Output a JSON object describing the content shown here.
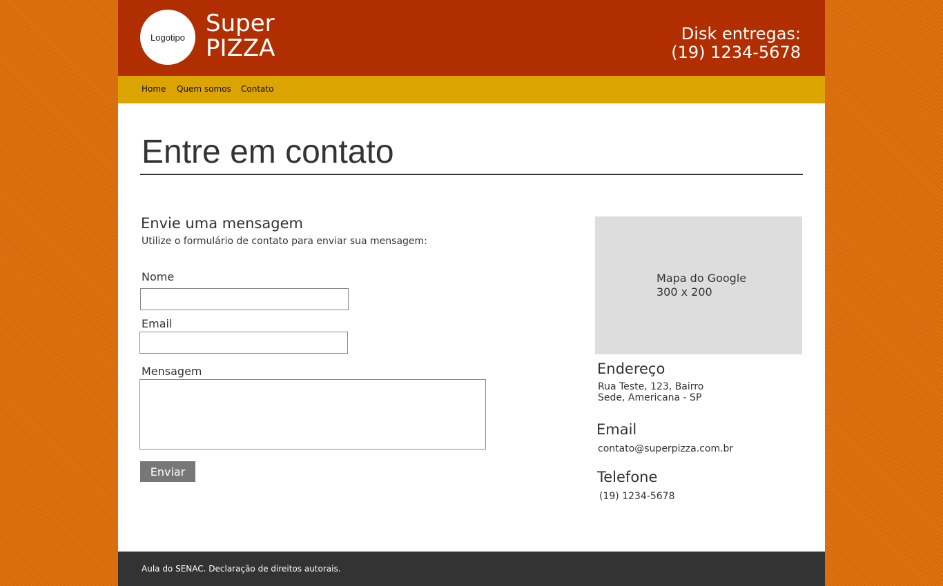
{
  "header": {
    "logo_text": "Logotipo",
    "brand_line1": "Super",
    "brand_line2": "PIZZA",
    "delivery_line1": "Disk entregas:",
    "delivery_line2": "(19) 1234-5678"
  },
  "nav": {
    "items": [
      {
        "label": "Home"
      },
      {
        "label": "Quem somos"
      },
      {
        "label": "Contato"
      }
    ]
  },
  "main": {
    "title": "Entre em contato"
  },
  "form": {
    "heading": "Envie uma mensagem",
    "subtitle": "Utilize o formulário de contato para enviar sua mensagem:",
    "name_label": "Nome",
    "name_value": "",
    "email_label": "Email",
    "email_value": "",
    "message_label": "Mensagem",
    "message_value": "",
    "submit_label": "Enviar"
  },
  "sidebar": {
    "map_line1": "Mapa do Google",
    "map_line2": "300 x 200",
    "address_heading": "Endereço",
    "address_line1": "Rua Teste, 123, Bairro",
    "address_line2": "Sede, Americana - SP",
    "email_heading": "Email",
    "email_value": "contato@superpizza.com.br",
    "phone_heading": "Telefone",
    "phone_value": "(19) 1234-5678"
  },
  "footer": {
    "text": "Aula do SENAC. Declaração de direitos autorais."
  },
  "colors": {
    "background": "#dc6d08",
    "header": "#b02e00",
    "nav": "#dba400",
    "footer": "#333333",
    "button": "#777777",
    "map_placeholder": "#dddddd"
  }
}
